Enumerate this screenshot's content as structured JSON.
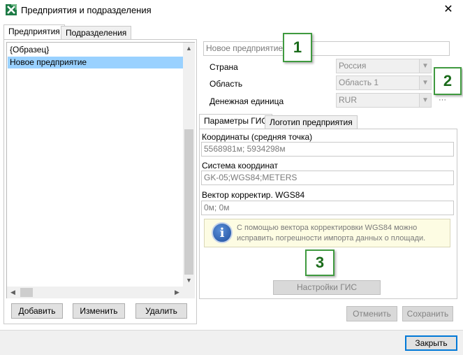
{
  "window": {
    "title": "Предприятия и подразделения",
    "close_glyph": "✕",
    "app_icon": "excel-like-icon"
  },
  "left_tabs": [
    {
      "label": "Предприятия",
      "active": true
    },
    {
      "label": "Подразделения",
      "active": false
    }
  ],
  "enterprise_list": {
    "items": [
      {
        "label": "{Образец}",
        "selected": false
      },
      {
        "label": "Новое предприятие",
        "selected": true
      }
    ]
  },
  "left_buttons": {
    "add": "Добавить",
    "edit": "Изменить",
    "delete": "Удалить"
  },
  "details": {
    "name_value": "Новое предприятие",
    "country_label": "Страна",
    "country_value": "Россия",
    "region_label": "Область",
    "region_value": "Область 1",
    "currency_label": "Денежная единица",
    "currency_value": "RUR",
    "ellipsis": "···"
  },
  "right_tabs": [
    {
      "label": "Параметры ГИС",
      "active": true
    },
    {
      "label": "Логотип предприятия",
      "active": false
    }
  ],
  "gis": {
    "coords_label": "Координаты (средняя точка)",
    "coords_value": "5568981м; 5934298м",
    "system_label": "Система координат",
    "system_value": "GK-05;WGS84;METERS",
    "vector_label": "Вектор корректир. WGS84",
    "vector_value": "0м; 0м",
    "info_text": "С помощью вектора корректировки WGS84 можно исправить погрешности импорта данных о площади.",
    "settings_button": "Настройки ГИС"
  },
  "form_buttons": {
    "cancel": "Отменить",
    "save": "Сохранить"
  },
  "footer": {
    "close": "Закрыть"
  },
  "callouts": [
    "1",
    "2",
    "3"
  ],
  "colors": {
    "selection": "#99d1ff",
    "callout_border": "#3f9a3f",
    "primary_border": "#0078d7"
  }
}
